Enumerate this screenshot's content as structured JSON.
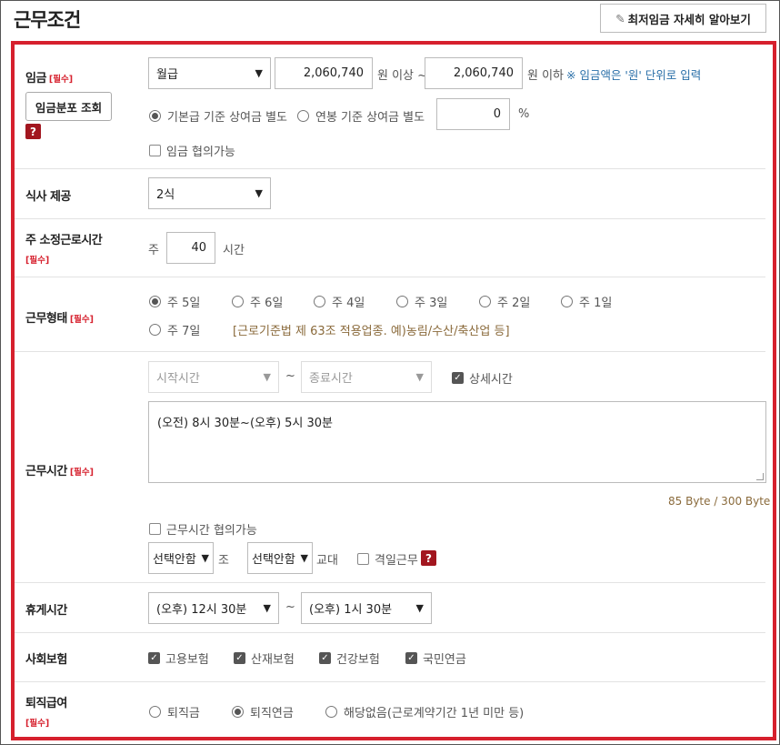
{
  "header": {
    "title": "근무조건",
    "min_wage_button": "최저임금 자세히 알아보기"
  },
  "required_tag": "[필수]",
  "wage": {
    "label": "임금",
    "type_selected": "월급",
    "min_amount": "2,060,740",
    "min_suffix": "원 이상 ~",
    "max_amount": "2,060,740",
    "max_suffix": "원 이하",
    "note": "※ 임금액은 '원' 단위로 입력",
    "distribution_button": "임금분포 조회",
    "bonus_radio_1": "기본급 기준 상여금 별도",
    "bonus_radio_2": "연봉 기준 상여금 별도",
    "bonus_percent": "0",
    "percent_unit": "%",
    "negotiable": "임금 협의가능"
  },
  "meal": {
    "label": "식사 제공",
    "selected": "2식"
  },
  "weekly_hours": {
    "label": "주 소정근로시간",
    "prefix": "주",
    "value": "40",
    "unit": "시간"
  },
  "work_type": {
    "label": "근무형태",
    "options": [
      "주 5일",
      "주 6일",
      "주 4일",
      "주 3일",
      "주 2일",
      "주 1일",
      "주 7일"
    ],
    "selected_index": 0,
    "note": "[근로기준법 제 63조 적용업종. 예)농림/수산/축산업 등]"
  },
  "work_hours": {
    "label": "근무시간",
    "start_placeholder": "시작시간",
    "tilde": "~",
    "end_placeholder": "종료시간",
    "detail_label": "상세시간",
    "detail_text": "(오전) 8시 30분~(오후) 5시 30분",
    "byte_count": "85 Byte / 300 Byte",
    "negotiable": "근무시간 협의가능",
    "shift_select_1": "선택안함",
    "shift_suffix_1": "조",
    "shift_select_2": "선택안함",
    "shift_suffix_2": "교대",
    "alternate_day": "격일근무"
  },
  "break_time": {
    "label": "휴게시간",
    "start": "(오후) 12시 30분",
    "tilde": "~",
    "end": "(오후) 1시 30분"
  },
  "insurance": {
    "label": "사회보험",
    "items": [
      "고용보험",
      "산재보험",
      "건강보험",
      "국민연금"
    ]
  },
  "retirement": {
    "label": "퇴직급여",
    "options": [
      "퇴직금",
      "퇴직연금",
      "해당없음(근로계약기간 1년 미만 등)"
    ],
    "selected_index": 1
  },
  "icons": {
    "question": "?",
    "pencil": "✎",
    "check": "✓"
  },
  "colors": {
    "accent_red": "#d6202d",
    "question_bg": "#a2161f",
    "note_brown": "#8a6a3b",
    "link_blue": "#2a6fa8"
  }
}
